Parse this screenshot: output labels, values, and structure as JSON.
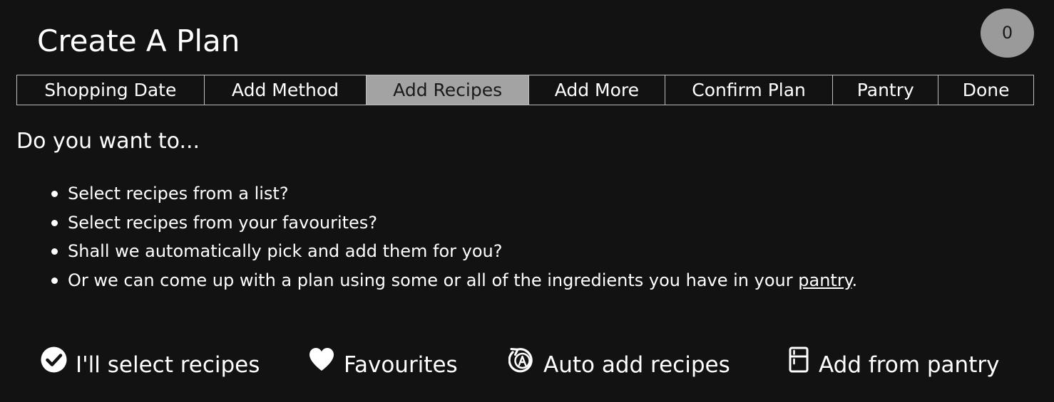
{
  "header": {
    "title": "Create A Plan",
    "counter": "0"
  },
  "steps": [
    {
      "label": "Shopping Date",
      "active": false
    },
    {
      "label": "Add Method",
      "active": false
    },
    {
      "label": "Add Recipes",
      "active": true
    },
    {
      "label": "Add More",
      "active": false
    },
    {
      "label": "Confirm Plan",
      "active": false
    },
    {
      "label": "Pantry",
      "active": false
    },
    {
      "label": "Done",
      "active": false
    }
  ],
  "content": {
    "question": "Do you want to...",
    "options": [
      "Select recipes from a list?",
      "Select recipes from your favourites?",
      "Shall we automatically pick and add them for you?"
    ],
    "pantry_option": {
      "prefix": "Or we can come up with a plan using some or all of the ingredients you have in your ",
      "link": "pantry",
      "suffix": "."
    }
  },
  "actions": [
    {
      "label": "I'll select recipes",
      "icon": "check-circle-icon"
    },
    {
      "label": "Favourites",
      "icon": "heart-icon"
    },
    {
      "label": "Auto add recipes",
      "icon": "auto-a-icon"
    },
    {
      "label": "Add from pantry",
      "icon": "fridge-icon"
    }
  ],
  "colors": {
    "background": "#121212",
    "text": "#ffffff",
    "active_tab": "#a3a3a3",
    "badge": "#9a9a9a",
    "border": "#bdbdbd"
  }
}
